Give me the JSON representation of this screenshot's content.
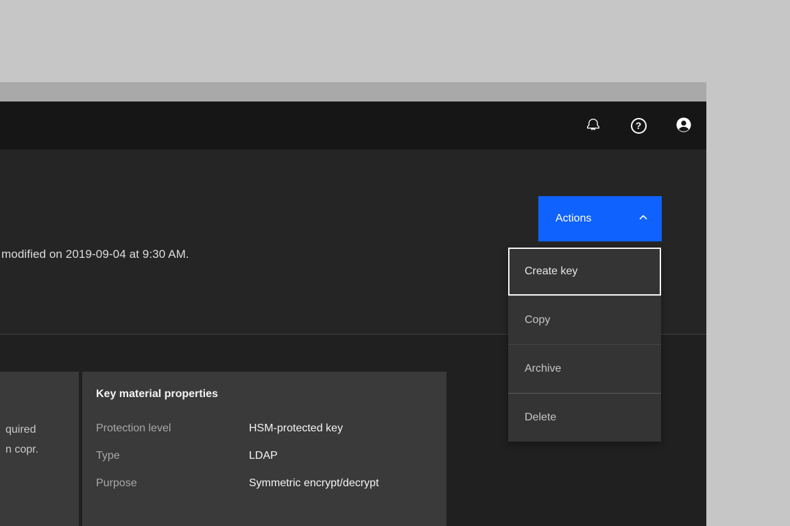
{
  "colors": {
    "accent_blue": "#0f62fe",
    "header_bg": "#161616",
    "page_top_bg": "#252526",
    "page_bottom_bg": "#202020",
    "tile_bg": "#3a3a3a",
    "outer_bg": "#c6c6c6",
    "titlebar_bg": "#a9a9a9"
  },
  "header": {
    "icons": {
      "notification": "bell-icon",
      "help_glyph": "?",
      "avatar": "user-avatar-icon"
    }
  },
  "page_header": {
    "modified_text": "modified on 2019-09-04 at 9:30 AM.",
    "actions_button_label": "Actions"
  },
  "actions_menu": {
    "items": [
      {
        "label": "Create key",
        "focused": true
      },
      {
        "label": "Copy",
        "focused": false
      },
      {
        "label": "Archive",
        "focused": false
      },
      {
        "label": "Delete",
        "focused": false
      }
    ]
  },
  "tiles": {
    "left_partial": {
      "line1": "quired",
      "line2": "n copr."
    },
    "key_material": {
      "title": "Key material properties",
      "rows": [
        {
          "label": "Protection level",
          "value": "HSM-protected key"
        },
        {
          "label": "Type",
          "value": "LDAP"
        },
        {
          "label": "Purpose",
          "value": "Symmetric encrypt/decrypt"
        }
      ]
    }
  }
}
